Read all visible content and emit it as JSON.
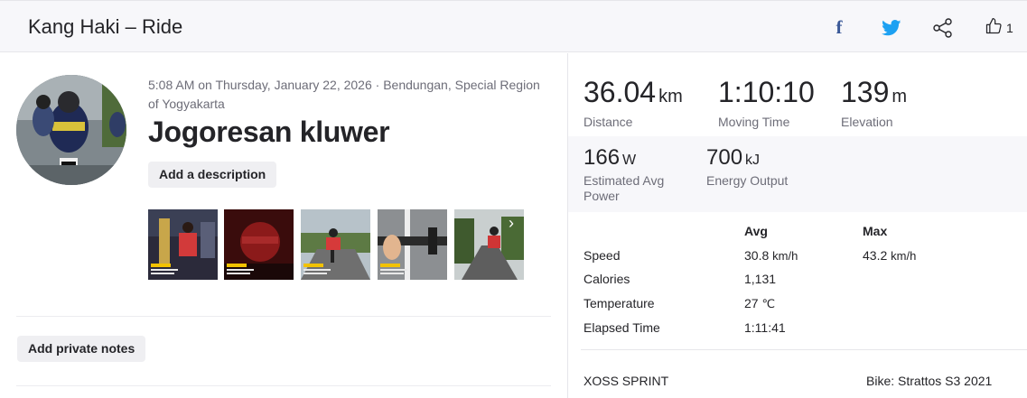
{
  "header": {
    "title": "Kang Haki – Ride",
    "facebook_glyph": "f",
    "kudos_count": "1"
  },
  "activity": {
    "meta": "5:08 AM on Thursday, January 22, 2026 · Bendungan, Special Region of Yogyakarta",
    "name": "Jogoresan kluwer",
    "add_description_label": "Add a description",
    "add_private_notes_label": "Add private notes",
    "more_photos_glyph": "›"
  },
  "photos": [
    {
      "scene": "night-street-rider-red-shirt",
      "color": "#4a3a35"
    },
    {
      "scene": "red-lit-night-ride",
      "color": "#7a1c1c"
    },
    {
      "scene": "rider-on-road-greenery",
      "color": "#8d9a7a"
    },
    {
      "scene": "handlebar-cockpit-view",
      "color": "#a7a7a7"
    },
    {
      "scene": "rider-road-trees-dawn",
      "color": "#5f6e55"
    }
  ],
  "primary_stats": [
    {
      "value": "36.04",
      "unit": "km",
      "label": "Distance"
    },
    {
      "value": "1:10:10",
      "unit": "",
      "label": "Moving Time"
    },
    {
      "value": "139",
      "unit": "m",
      "label": "Elevation"
    }
  ],
  "secondary_stats": [
    {
      "value": "166",
      "unit": "W",
      "label": "Estimated Avg Power"
    },
    {
      "value": "700",
      "unit": "kJ",
      "label": "Energy Output"
    }
  ],
  "details_table": {
    "avg_header": "Avg",
    "max_header": "Max",
    "rows": [
      {
        "label": "Speed",
        "avg": "30.8",
        "avg_unit": "km/h",
        "max": "43.2",
        "max_unit": "km/h"
      },
      {
        "label": "Calories",
        "avg": "1,131",
        "avg_unit": "",
        "max": "",
        "max_unit": ""
      },
      {
        "label": "Temperature",
        "avg": "27",
        "avg_unit": "℃",
        "max": "",
        "max_unit": ""
      },
      {
        "label": "Elapsed Time",
        "avg": "1:11:41",
        "avg_unit": "",
        "max": "",
        "max_unit": ""
      }
    ]
  },
  "device": "XOSS SPRINT",
  "bike": "Bike: Strattos S3 2021",
  "colors": {
    "facebook": "#3b5998",
    "twitter": "#1da1f2",
    "header_bg": "#f7f7fa",
    "button_bg": "#efeff2",
    "muted_text": "#6d6d78"
  }
}
